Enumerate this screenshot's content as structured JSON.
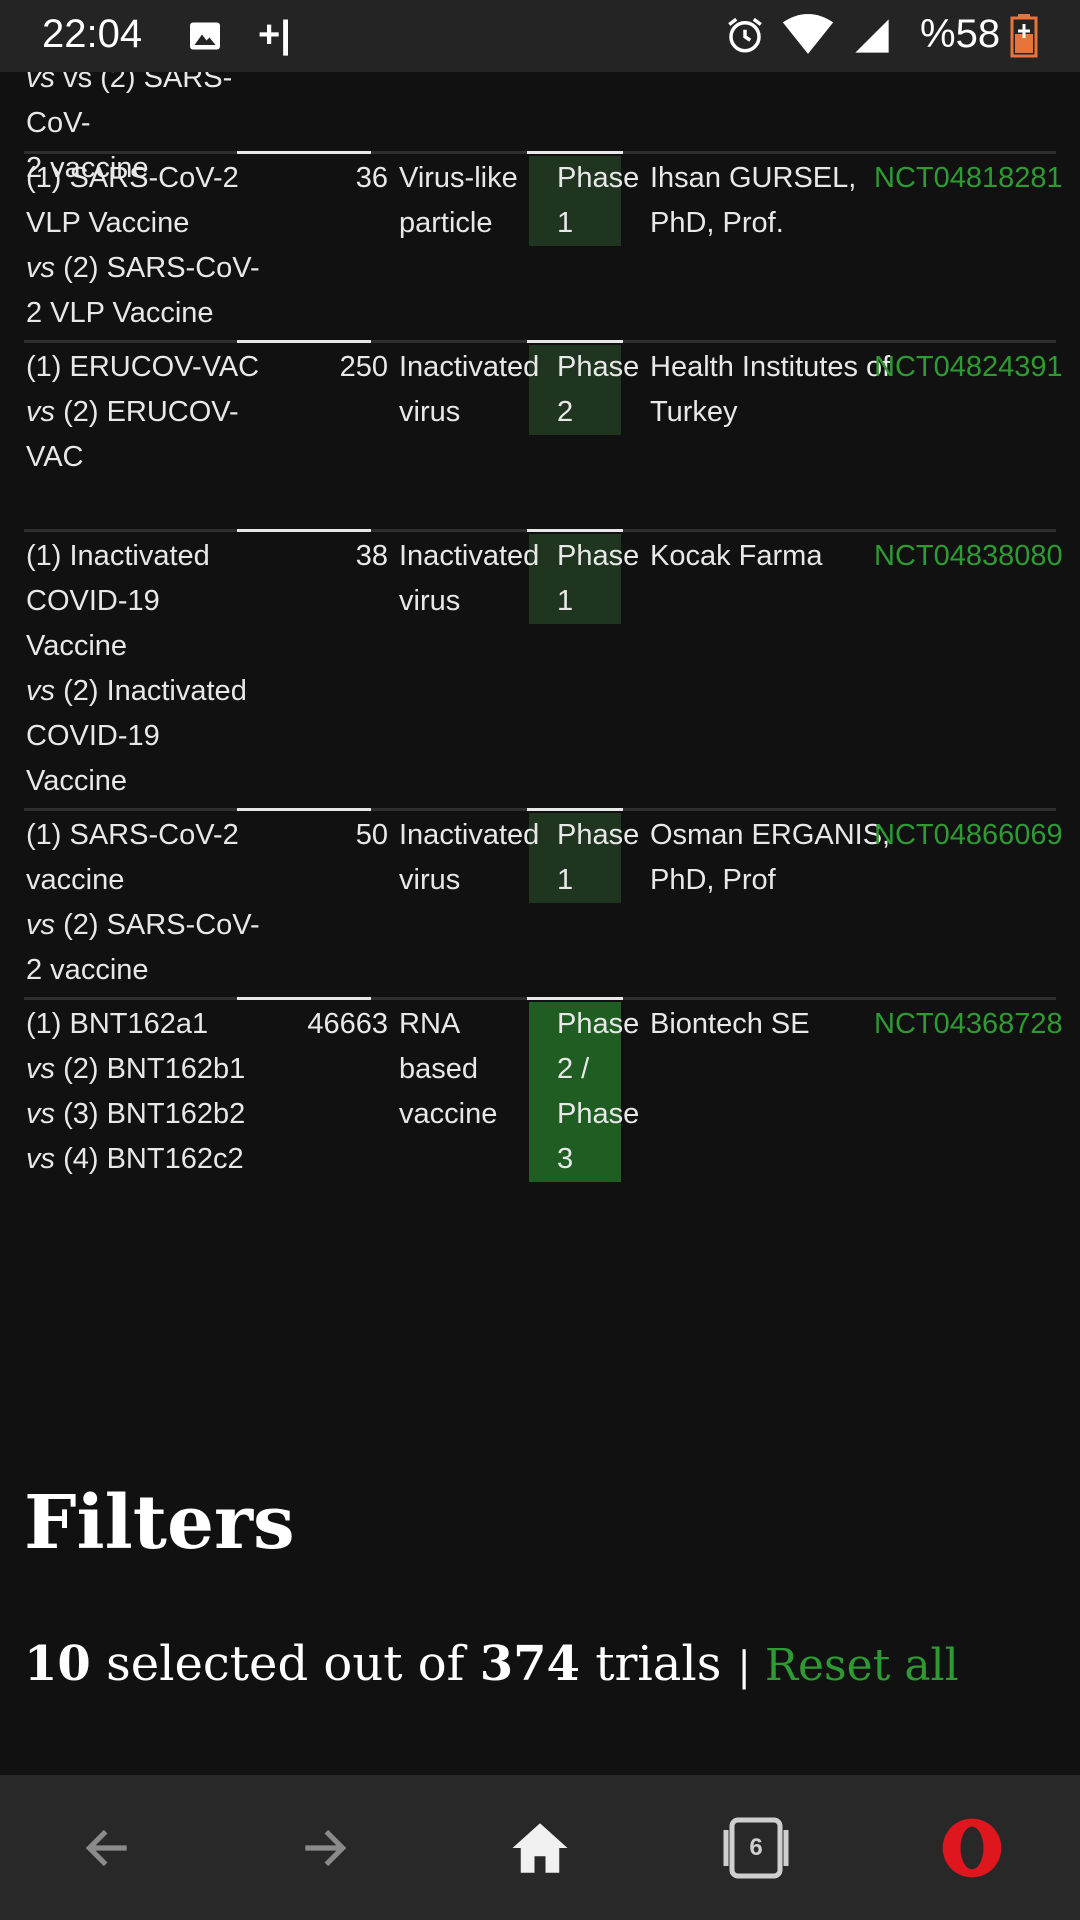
{
  "status_bar": {
    "time": "22:04",
    "plus_indicator": "+|",
    "battery_text": "%58",
    "icons": [
      "image-icon",
      "alarm-icon",
      "wifi-icon",
      "signal-icon",
      "battery-icon"
    ]
  },
  "table": {
    "partial_row": {
      "name_line1": "vs (2) SARS-CoV-",
      "name_line2": "2 vaccine"
    },
    "rows": [
      {
        "name_a": "(1) SARS-CoV-2 VLP Vaccine",
        "vs": "vs",
        "name_b": "(2) SARS-CoV-2 VLP Vaccine",
        "n": "36",
        "type": "Virus-like particle",
        "phase": "Phase 1",
        "sponsor": "Ihsan GURSEL, PhD, Prof.",
        "id": "NCT04818281"
      },
      {
        "name_a": "(1) ERUCOV-VAC",
        "vs": "vs",
        "name_b": "(2) ERUCOV-VAC",
        "n": "250",
        "type": "Inactivated virus",
        "phase": "Phase 2",
        "sponsor": "Health Institutes of Turkey",
        "id": "NCT04824391"
      },
      {
        "name_a": "(1) Inactivated COVID-19 Vaccine",
        "vs": "vs",
        "name_b": "(2) Inactivated COVID-19 Vaccine",
        "n": "38",
        "type": "Inactivated virus",
        "phase": "Phase 1",
        "sponsor": "Kocak Farma",
        "id": "NCT04838080"
      },
      {
        "name_a": "(1) SARS-CoV-2 vaccine",
        "vs": "vs",
        "name_b": "(2) SARS-CoV-2 vaccine",
        "n": "50",
        "type": "Inactivated virus",
        "phase": "Phase 1",
        "sponsor": "Osman ERGANIS, PhD, Prof",
        "id": "NCT04866069"
      },
      {
        "name_a": "(1) BNT162a1",
        "vs_lines": [
          "(2) BNT162b1",
          "(3) BNT162b2",
          "(4) BNT162c2"
        ],
        "vs": "vs",
        "n": "46663",
        "type": "RNA based vaccine",
        "phase": "Phase 2 / Phase 3",
        "sponsor": "Biontech SE",
        "id": "NCT04368728"
      }
    ]
  },
  "filters": {
    "title": "Filters",
    "selected_count": "10",
    "selected_text": "selected out of",
    "total_count": "374",
    "total_text": "trials",
    "separator": "|",
    "reset_label": "Reset all"
  },
  "nav": {
    "tabs_count": "6",
    "icons": [
      "back-arrow-icon",
      "forward-arrow-icon",
      "home-icon",
      "tabs-icon",
      "opera-logo-icon"
    ]
  },
  "colors": {
    "background": "#111111",
    "link_green": "#2e9a32",
    "phase1_bg": "#203520",
    "phase23_bg": "#1f5d22"
  }
}
